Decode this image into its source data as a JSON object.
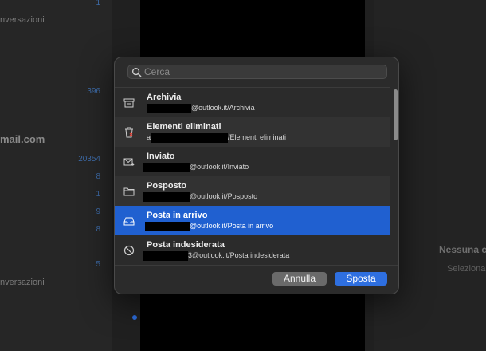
{
  "background": {
    "left_texts": [
      "nversazioni",
      "nversazioni"
    ],
    "account_label": "mail.com",
    "counts": [
      "1",
      "396",
      "20354",
      "8",
      "1",
      "9",
      "8",
      "5"
    ],
    "right_title": "Nessuna c",
    "right_subtitle": "Seleziona u"
  },
  "dialog": {
    "search": {
      "placeholder": "Cerca",
      "value": ""
    },
    "folders": [
      {
        "name": "Archivia",
        "path": "@outlook.it/Archivia",
        "icon": "archive-icon",
        "selected": false
      },
      {
        "name": "Elementi eliminati",
        "path": "/Elementi eliminati",
        "path_prefix": "a",
        "icon": "trash-icon",
        "selected": false
      },
      {
        "name": "Inviato",
        "path": "@outlook.it/Inviato",
        "icon": "sent-icon",
        "selected": false
      },
      {
        "name": "Posposto",
        "path": "@outlook.it/Posposto",
        "icon": "folder-icon",
        "selected": false
      },
      {
        "name": "Posta in arrivo",
        "path": "@outlook.it/Posta in arrivo",
        "icon": "inbox-icon",
        "selected": true
      },
      {
        "name": "Posta indesiderata",
        "path": "3@outlook.it/Posta indesiderata",
        "icon": "junk-icon",
        "selected": false
      }
    ],
    "cancel_label": "Annulla",
    "confirm_label": "Sposta"
  },
  "colors": {
    "selection": "#2060d0",
    "primary_button": "#2e6fe0",
    "count_blue": "#3d6aa6"
  }
}
